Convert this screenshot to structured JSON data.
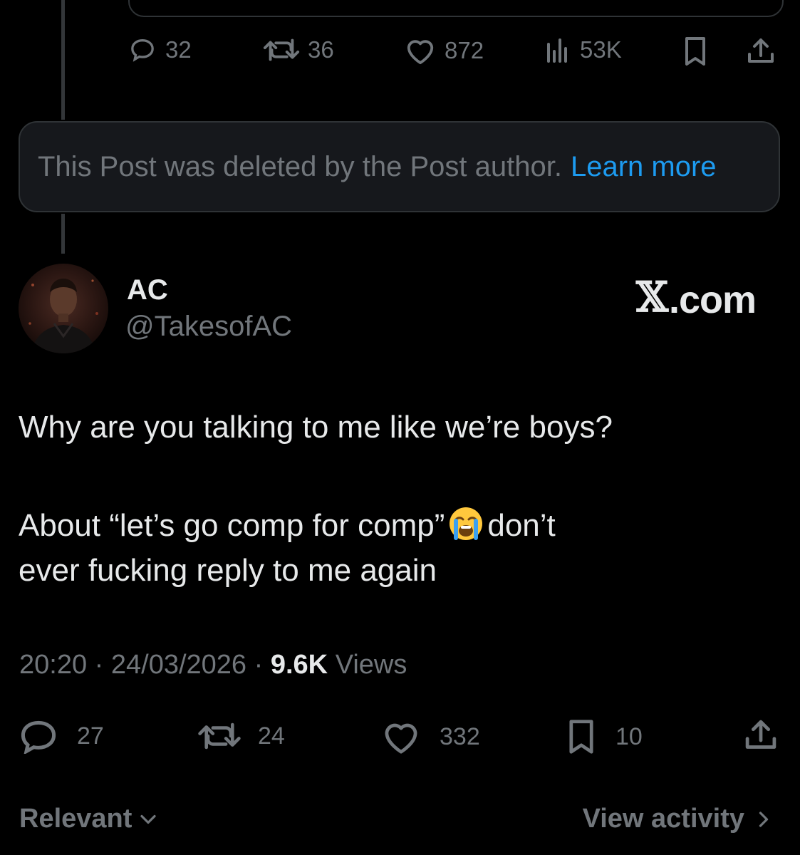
{
  "previous_post": {
    "actions": {
      "replies": "32",
      "reposts": "36",
      "likes": "872",
      "views": "53K"
    }
  },
  "deleted_notice": {
    "text": "This Post was deleted by the Post author.",
    "link": "Learn more"
  },
  "post": {
    "author_name": "AC",
    "author_handle": "@TakesofAC",
    "brand": ".com",
    "lines": [
      "Why are you talking to me like we’re boys?",
      "About “let’s go comp for comp”",
      "don’t",
      "ever fucking reply to me again"
    ],
    "time": "20:20",
    "date": "24/03/2026",
    "views_count": "9.6K",
    "views_label": "Views",
    "actions": {
      "replies": "27",
      "reposts": "24",
      "likes": "332",
      "bookmarks": "10"
    }
  },
  "footer": {
    "sort_label": "Relevant",
    "view_activity": "View activity"
  },
  "colors": {
    "background": "#000000",
    "primary_text": "#e7e9ea",
    "secondary_text": "#71767b",
    "link": "#1d9bf0",
    "card_bg": "#16181c",
    "border": "#2f3336"
  }
}
